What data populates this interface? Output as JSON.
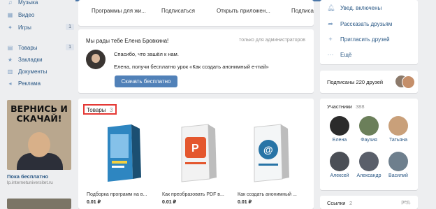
{
  "left_nav": {
    "items": [
      {
        "label": "Музыка",
        "icon": "music-icon",
        "count": ""
      },
      {
        "label": "Видео",
        "icon": "video-icon",
        "count": ""
      },
      {
        "label": "Игры",
        "icon": "games-icon",
        "count": "1"
      },
      {
        "label": "Товары",
        "icon": "goods-icon",
        "count": "1"
      },
      {
        "label": "Закладки",
        "icon": "bookmark-icon",
        "count": ""
      },
      {
        "label": "Документы",
        "icon": "documents-icon",
        "count": ""
      },
      {
        "label": "Реклама",
        "icon": "ads-icon",
        "count": ""
      }
    ]
  },
  "ad": {
    "image_text": "ВЕРНИСЬ И СКАЧАЙ!",
    "title": "Пока бесплатно",
    "url": "lp.internetuniversitet.ru"
  },
  "tabs": {
    "items": [
      "Программы для жи...",
      "Подписаться",
      "Открыть приложен...",
      "Подписа"
    ]
  },
  "message": {
    "greeting": "Мы рады тебе Елена Бровкина!",
    "admin_note": "только для администраторов",
    "line1": "Спасибо, что зашёл к нам.",
    "line2": "Елена, получи бесплатно урок «Как создать анонимный e-mail»",
    "button": "Скачать бесплатно"
  },
  "goods": {
    "title": "Товары",
    "count": "3",
    "products": [
      {
        "caption": "Подборка программ на в...",
        "price": "0.01 ₽"
      },
      {
        "caption": "Как преобразовать PDF в...",
        "price": "0.01 ₽"
      },
      {
        "caption": "Как создать анонимный ...",
        "price": "0.01 ₽"
      }
    ]
  },
  "actions": {
    "items": [
      {
        "label": "Увед. включены",
        "icon": "bell-icon"
      },
      {
        "label": "Рассказать друзьям",
        "icon": "share-icon"
      },
      {
        "label": "Пригласить друзей",
        "icon": "invite-icon"
      },
      {
        "label": "Ещё",
        "icon": "more-icon"
      }
    ]
  },
  "subs": {
    "label": "Подписаны 220 друзей"
  },
  "members": {
    "title": "Участники",
    "count": "388",
    "people": [
      "Елена",
      "Фаузия",
      "Татьяна",
      "Алексей",
      "Александр",
      "Василий"
    ]
  },
  "links": {
    "title": "Ссылки",
    "count": "2",
    "edit": "ред."
  },
  "colors": {
    "accent": "#5181b8",
    "link": "#2a5885",
    "highlight": "#e53935"
  }
}
